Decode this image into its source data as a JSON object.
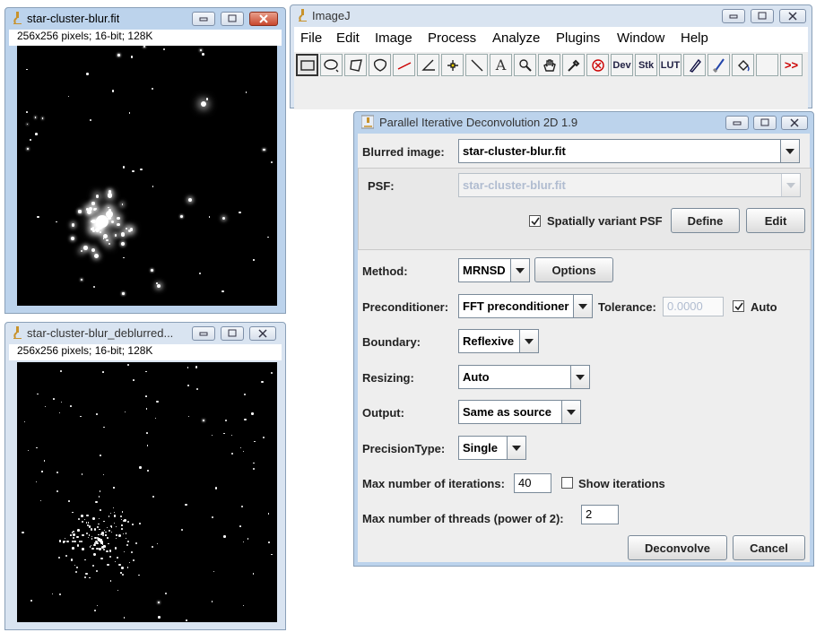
{
  "windows": {
    "blurred": {
      "title": "star-cluster-blur.fit",
      "info": "256x256 pixels; 16-bit; 128K"
    },
    "deblurred": {
      "title": "star-cluster-blur_deblurred...",
      "info": "256x256 pixels; 16-bit; 128K"
    },
    "imagej": {
      "title": "ImageJ",
      "menu": [
        "File",
        "Edit",
        "Image",
        "Process",
        "Analyze",
        "Plugins",
        "Window",
        "Help"
      ],
      "tools": {
        "dev": "Dev",
        "stk": "Stk",
        "lut": "LUT",
        "more": ">>"
      }
    },
    "dialog": {
      "title": "Parallel Iterative Deconvolution 2D 1.9",
      "blurred_label": "Blurred image:",
      "blurred_value": "star-cluster-blur.fit",
      "psf_label": "PSF:",
      "psf_value": "star-cluster-blur.fit",
      "spatially_variant_label": "Spatially variant PSF",
      "define_label": "Define",
      "edit_label": "Edit",
      "method_label": "Method:",
      "method_value": "MRNSD",
      "options_label": "Options",
      "preconditioner_label": "Preconditioner:",
      "preconditioner_value": "FFT preconditioner",
      "tolerance_label": "Tolerance:",
      "tolerance_value": "0.0000",
      "auto_label": "Auto",
      "boundary_label": "Boundary:",
      "boundary_value": "Reflexive",
      "resizing_label": "Resizing:",
      "resizing_value": "Auto",
      "output_label": "Output:",
      "output_value": "Same as source",
      "precision_label": "PrecisionType:",
      "precision_value": "Single",
      "iterations_label": "Max number of iterations:",
      "iterations_value": "40",
      "show_iterations_label": "Show iterations",
      "threads_label": "Max number of threads (power of 2):",
      "threads_value": "2",
      "deconvolve_label": "Deconvolve",
      "cancel_label": "Cancel"
    }
  },
  "colors": {
    "active_frame": "#bcd3ec",
    "inactive_frame": "#d9e4f1",
    "close_red": "#c8472d",
    "tool_red": "#cc0000"
  }
}
